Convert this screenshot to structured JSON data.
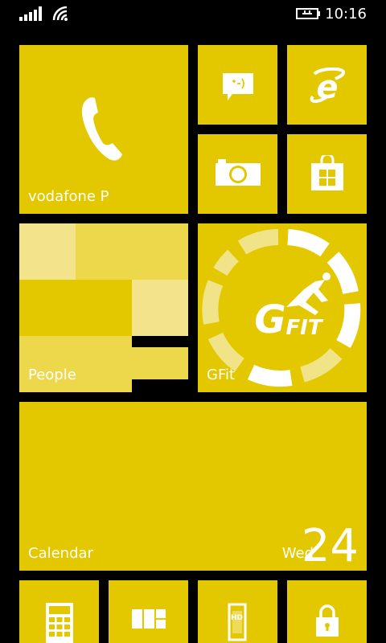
{
  "status_bar": {
    "time": "10:16",
    "signal": "signal-bars-icon",
    "wifi": "wifi-icon",
    "battery": "battery-charging-icon"
  },
  "tiles": {
    "phone": {
      "label": "vodafone P",
      "icon": "phone-icon"
    },
    "messaging": {
      "icon": "messaging-icon"
    },
    "browser": {
      "icon": "internet-explorer-icon"
    },
    "camera": {
      "icon": "camera-icon"
    },
    "store": {
      "icon": "store-icon"
    },
    "people": {
      "label": "People"
    },
    "gfit": {
      "label": "GFit",
      "logo_text": "GFIT"
    },
    "calendar": {
      "label": "Calendar",
      "day": "Wed",
      "date": "24"
    },
    "calculator": {
      "icon": "calculator-icon"
    },
    "office": {
      "icon": "office-icon"
    },
    "hd_app": {
      "icon": "hd-phone-icon",
      "badge": "HD"
    },
    "lock": {
      "icon": "lock-icon"
    }
  },
  "colors": {
    "accent": "#e3c800",
    "background": "#000000"
  }
}
